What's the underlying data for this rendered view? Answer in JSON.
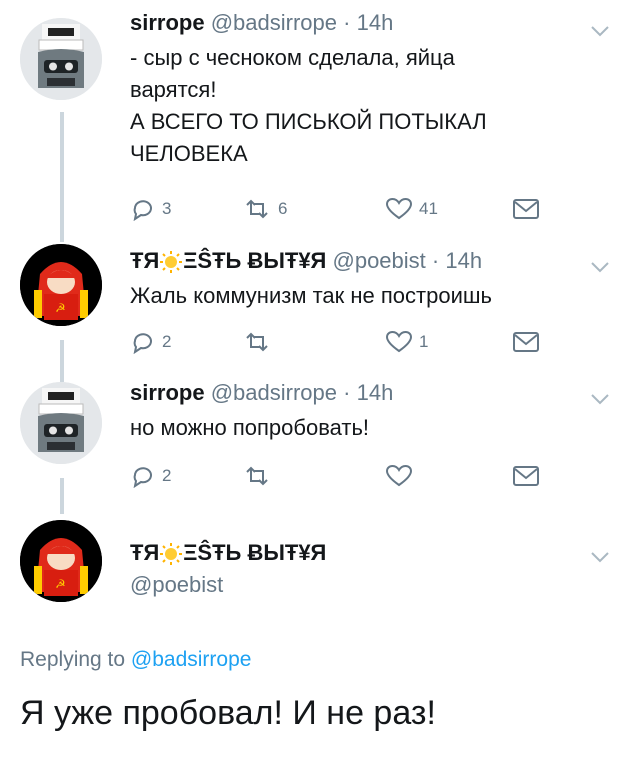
{
  "tweets": [
    {
      "name": "sirrope",
      "handle": "@badsirrope",
      "dot": "·",
      "time": "14h",
      "text": "- сыр с чесноком сделала, яйца\nварятся!\nА ВСЕГО ТО ПИСЬКОЙ ПОТЫКАЛ\nЧЕЛОВЕКА",
      "replies": "3",
      "retweets": "6",
      "likes": "41"
    },
    {
      "name_pre": "ŦЯ",
      "name_post": "ΞŜŦЬ ɃЫŦ¥Я",
      "handle": "@poebist",
      "dot": "·",
      "time": "14h",
      "text": "Жаль коммунизм так не построишь",
      "replies": "2",
      "retweets": "",
      "likes": "1"
    },
    {
      "name": "sirrope",
      "handle": "@badsirrope",
      "dot": "·",
      "time": "14h",
      "text": "но можно попробовать!",
      "replies": "2",
      "retweets": "",
      "likes": ""
    }
  ],
  "main_tweet": {
    "name_pre": "ŦЯ",
    "name_post": "ΞŜŦЬ ɃЫŦ¥Я",
    "handle": "@poebist",
    "replying_prefix": "Replying to",
    "replying_handle": "@badsirrope",
    "text": "Я уже пробовал! И не раз!"
  },
  "icons": {
    "reply": "reply-icon",
    "retweet": "retweet-icon",
    "like": "heart-icon",
    "dm": "envelope-icon",
    "menu": "chevron-down-icon",
    "sun": "sun-emoji-icon"
  },
  "colors": {
    "text": "#14171a",
    "muted": "#657786",
    "link": "#1da1f2",
    "thread_line": "#ccd6dd"
  }
}
